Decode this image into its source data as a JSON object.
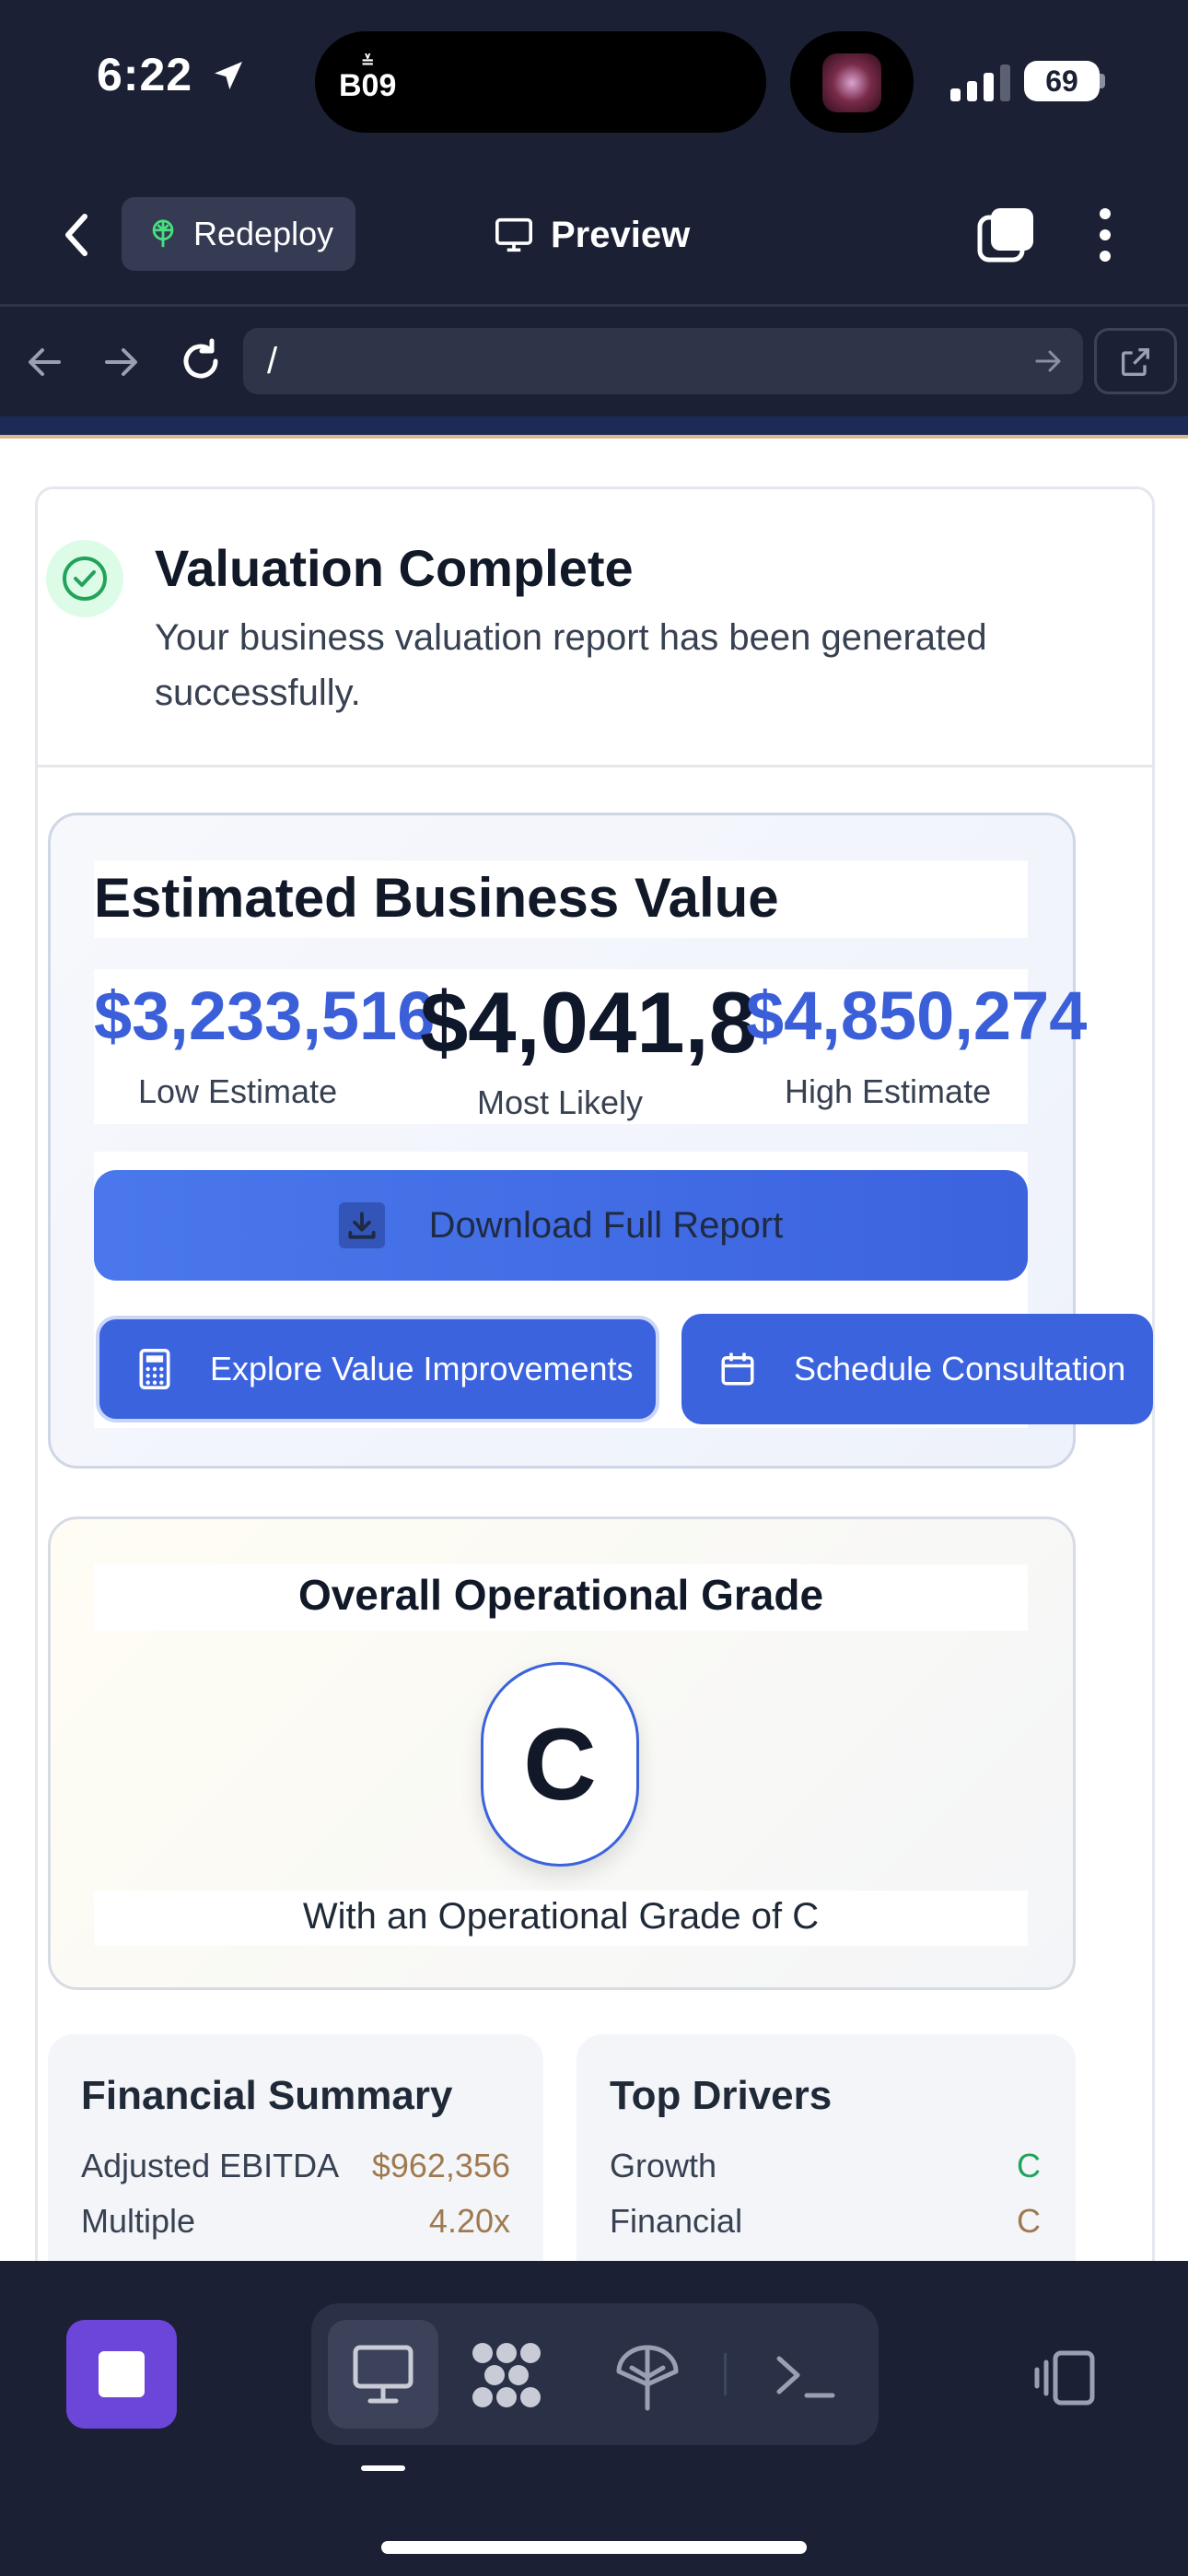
{
  "status_bar": {
    "time": "6:22",
    "island_logo_top": "≚",
    "island_logo": "B09",
    "battery": "69"
  },
  "header": {
    "redeploy_label": "Redeploy",
    "preview_label": "Preview"
  },
  "url_bar": {
    "url": "/"
  },
  "valuation": {
    "title": "Valuation Complete",
    "description": "Your business valuation report has been generated successfully."
  },
  "estimate": {
    "title": "Estimated Business Value",
    "low_value": "$3,233,516",
    "low_label": "Low Estimate",
    "mid_value": "$4,041,8",
    "mid_label": "Most Likely",
    "high_value": "$4,850,274",
    "high_label": "High Estimate",
    "download_label": "Download Full Report",
    "explore_label": "Explore Value Improvements",
    "schedule_label": "Schedule Consultation"
  },
  "grade": {
    "title": "Overall Operational Grade",
    "letter": "C",
    "subtitle": "With an Operational Grade of C"
  },
  "financial_summary": {
    "title": "Financial Summary",
    "rows": [
      {
        "label": "Adjusted EBITDA",
        "value": "$962,356"
      },
      {
        "label": "Multiple",
        "value": "4.20x"
      }
    ]
  },
  "top_drivers": {
    "title": "Top Drivers",
    "rows": [
      {
        "label": "Growth",
        "value": "C"
      },
      {
        "label": "Financial",
        "value": "C"
      }
    ]
  },
  "colors": {
    "accent_blue": "#3b63de",
    "stop_purple": "#6b46d8",
    "chrome_bg": "#1b2034",
    "success_green": "#22a35a"
  }
}
